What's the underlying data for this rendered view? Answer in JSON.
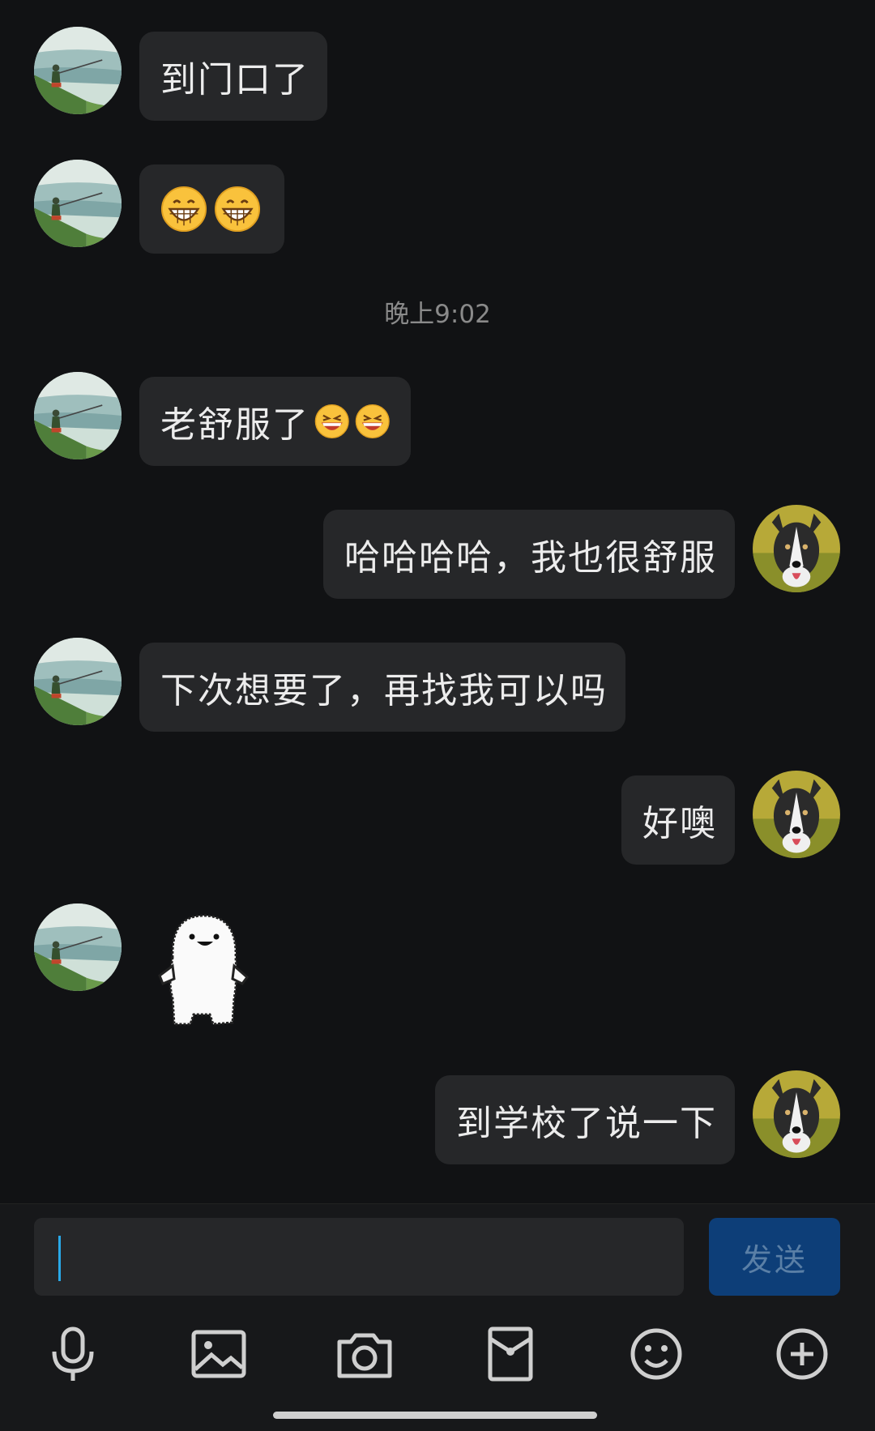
{
  "messages": [
    {
      "side": "left",
      "text": "到门口了"
    },
    {
      "side": "left",
      "emojis": [
        "grin-emoji",
        "grin-emoji"
      ]
    },
    {
      "side": "left",
      "text": "老舒服了",
      "emojis": [
        "laugh-emoji",
        "laugh-emoji"
      ]
    },
    {
      "side": "right",
      "text": "哈哈哈哈，我也很舒服"
    },
    {
      "side": "left",
      "text": "下次想要了，再找我可以吗"
    },
    {
      "side": "right",
      "text": "好噢"
    },
    {
      "side": "left",
      "sticker": "dancing-blob-sticker"
    },
    {
      "side": "right",
      "text": "到学校了说一下"
    }
  ],
  "timestamp": "晚上9:02",
  "composer": {
    "input_value": "",
    "send_label": "发送"
  },
  "toolbar": {
    "icons": [
      "microphone-icon",
      "image-icon",
      "camera-icon",
      "red-packet-icon",
      "emoji-icon",
      "plus-icon"
    ]
  },
  "colors": {
    "background": "#111214",
    "bubble": "#262729",
    "send_button": "#0d3e78",
    "caret": "#29a9e8"
  }
}
